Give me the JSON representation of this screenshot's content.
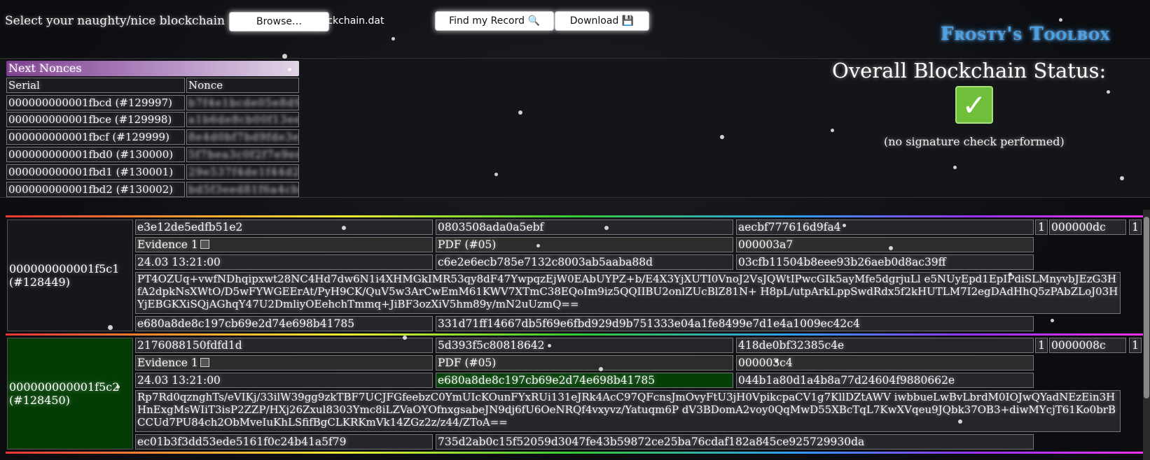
{
  "topbar": {
    "select_label": "Select your naughty/nice blockchain →",
    "browse_label": "Browse…",
    "filename": "blockchain.dat",
    "find_label": "Find my Record 🔍",
    "download_label": "Download 💾",
    "logo": "Frosty's Toolbox"
  },
  "nonces": {
    "title": "Next Nonces",
    "col_serial": "Serial",
    "col_nonce": "Nonce",
    "rows": [
      {
        "serial": "000000000001fbcd (#129997)",
        "nonce": "b7f4e1bcde05e8d9ga"
      },
      {
        "serial": "000000000001fbce (#129998)",
        "nonce": "a1b6de8cb00f13eed2"
      },
      {
        "serial": "000000000001fbcf (#129999)",
        "nonce": "8e4d0bf7bd9fde3e6a"
      },
      {
        "serial": "000000000001fbd0 (#130000)",
        "nonce": "5f7bea3c0f2f7e9ed1"
      },
      {
        "serial": "000000000001fbd1 (#130001)",
        "nonce": "29e537f4de1f44d2b7"
      },
      {
        "serial": "000000000001fbd2 (#130002)",
        "nonce": "bd5f3eed81f6a4cbe4"
      }
    ]
  },
  "status": {
    "title": "Overall Blockchain Status:",
    "note": "(no signature check performed)"
  },
  "records": [
    {
      "id": "000000000001f5c1 (#128449)",
      "h1": "e3e12de5edfb51e2",
      "h2": "0803508ada0a5ebf",
      "h3": "aecbf777616d9fa4",
      "n1": "1",
      "code": "000000dc",
      "n2": "1",
      "evidence": "Evidence 1",
      "pdf": "PDF (#05)",
      "len": "000003a7",
      "time": "24.03 13:21:00",
      "hash_md5": "c6e2e6ecb785e7132c8003ab5aaba88d",
      "hash_b": "03cfb11504b8eee93b26aeb0d8ac39ff",
      "signature": "PT4OZUq+vwfNDhqipxwt28NC4Hd7dw6N1i4XHMGkIMR53qy8dF47YwpqzEjW0EAbUYPZ+b/E4X3YjXUTI0VnoJ2VsJQWtIPwcGIk5ayMfe5dgrjuLl e5NUyEpd1EpIPdiSLMnyvbJEzG3HfA2dpkNsXWtO/D5wFYWGEErAt/PyH9CK/QuV5w3ArCwEmM61KWV7XTmC38EQoIm9iz5QQIIBU2onlZUcBlZ81N+ H8pL/utpArkLppSwdRdx5f2kHUTLM7I2egDAdHhQ5zPAbZLoJ03HYjEBGKXiSQjAGhqY47U2DmliyOEehchTmmq+JiBF3ozXiV5hm89y/mN2uUzmQ==",
      "prev": "e680a8de8c197cb69e2d74e698b41785",
      "sha": "331d71ff14667db5f69e6fbd929d9b751333e04a1fe8499e7d1e4a1009ec42c4"
    },
    {
      "id": "000000000001f5c2 (#128450)",
      "h1": "2176088150fdfd1d",
      "h2": "5d393f5c80818642",
      "h3": "418de0bf32385c4e",
      "n1": "1",
      "code": "0000008c",
      "n2": "1",
      "evidence": "Evidence 1",
      "pdf": "PDF (#05)",
      "len": "000003c4",
      "time": "24.03 13:21:00",
      "hash_md5": "e680a8de8c197cb69e2d74e698b41785",
      "hash_b": "044b1a80d1a4b8a77d24604f9880662e",
      "signature": "Rp7Rd0qznghTs/eVIKj/33ilW39gg9zkTBF7UCJFGfeebzC0YmUIcKOunFYxRUi131eJRk4AcC97QFcnsJmOvyFtU3jH0VpikcpaCV1g7KllDZtAWV iwbbueLwBvLbrdM0IOJwQYadNEzEin3HHnExgMsWIiT3isP2ZZP/HXj26Zxul8303Ymc8iLZVaOYOfnxgsabeJN9dj6fU6OeNRQf4vxyvz/Yatuqm6P dV3BDomA2voy0QqMwD55XBcTqL7KwXVqeu9JQbk37OB3+diwMYcjT61Ko0brBCCUd7PU84ch2ObMveIuKhLSfifBgCLKRKmVk14ZGz2z/z44/ZToA==",
      "prev": "ec01b3f3dd53ede5161f0c24b41a5f79",
      "sha": "735d2ab0c15f52059d3047fe43b59872ce25ba76cdaf182a845ce925729930da"
    }
  ],
  "colors": {
    "accent": "#4aa3e8",
    "ok": "#6fbf3a",
    "match_green": "#053f07"
  }
}
